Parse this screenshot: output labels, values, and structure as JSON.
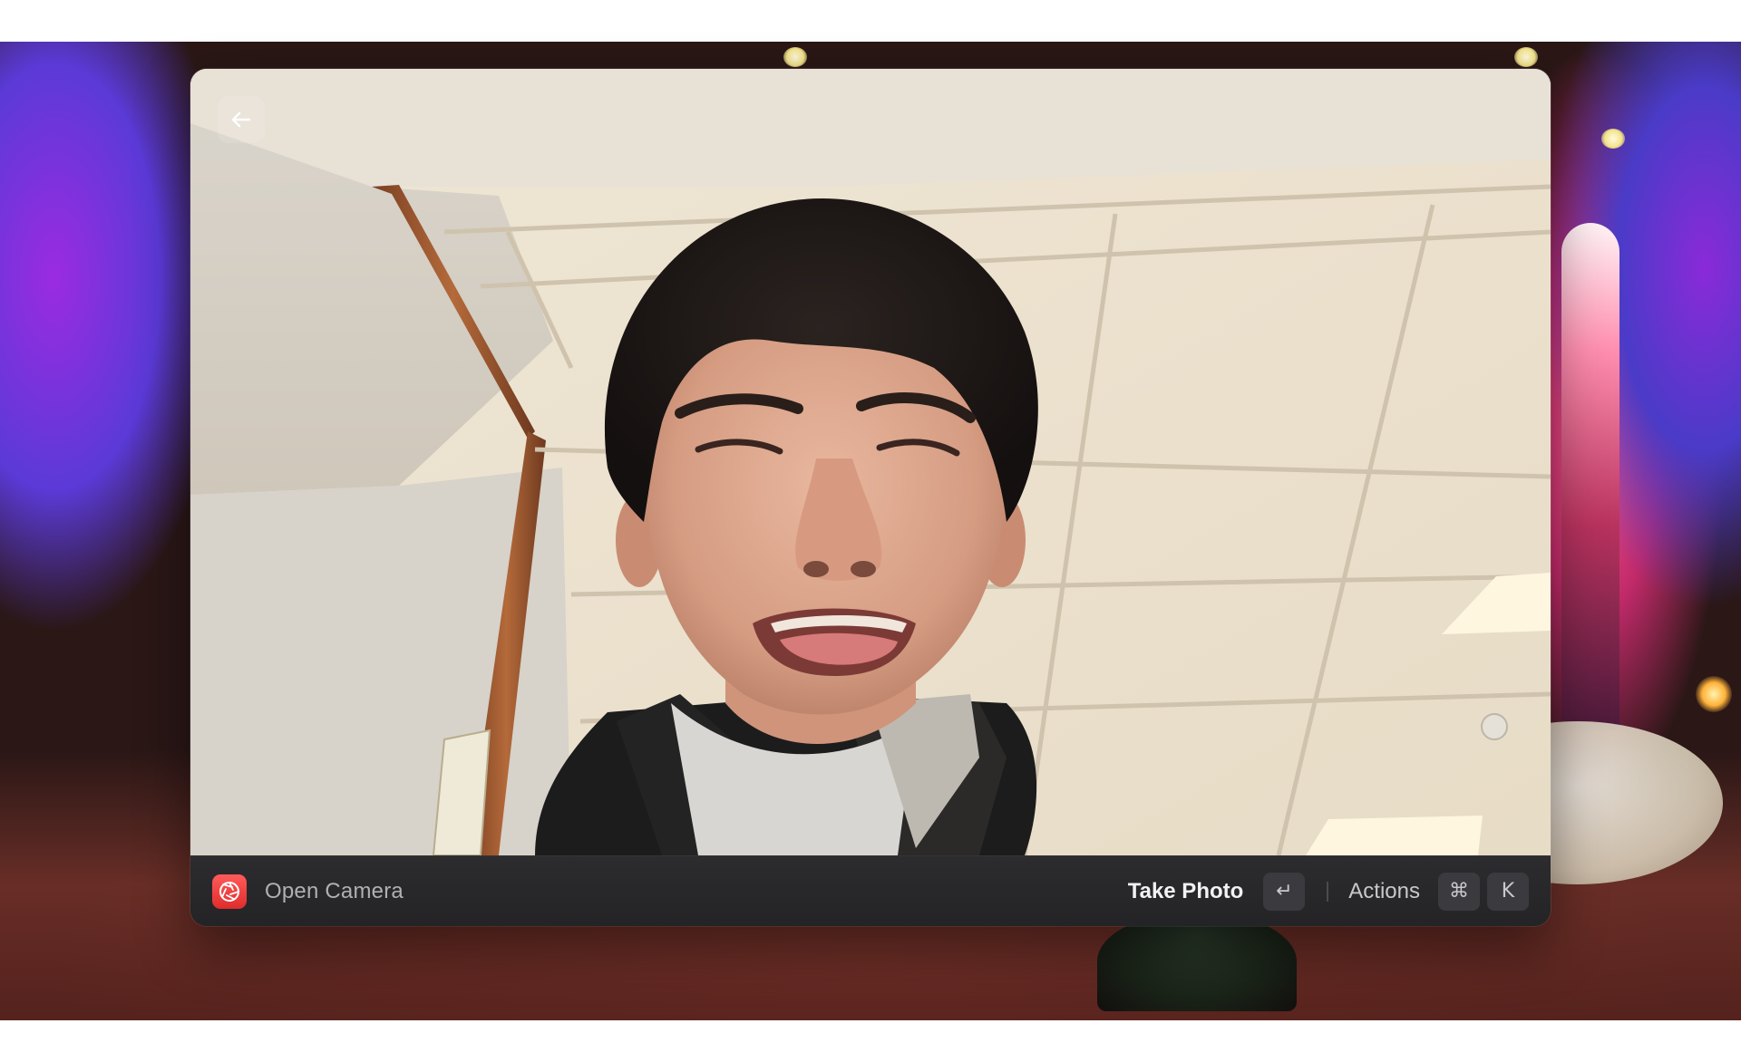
{
  "window": {
    "back_button_icon": "arrow-left-icon",
    "camera_feed": "live camera preview"
  },
  "action_bar": {
    "app_icon": "camera-aperture-icon",
    "app_name": "Open Camera",
    "primary_action_label": "Take Photo",
    "primary_action_shortcut": "↵",
    "actions_label": "Actions",
    "actions_shortcut_modifier": "⌘",
    "actions_shortcut_key": "K"
  },
  "colors": {
    "app_icon_red": "#e83a3a",
    "bar_background": "#2a2a2d",
    "kbd_background": "#3b3b3f"
  }
}
